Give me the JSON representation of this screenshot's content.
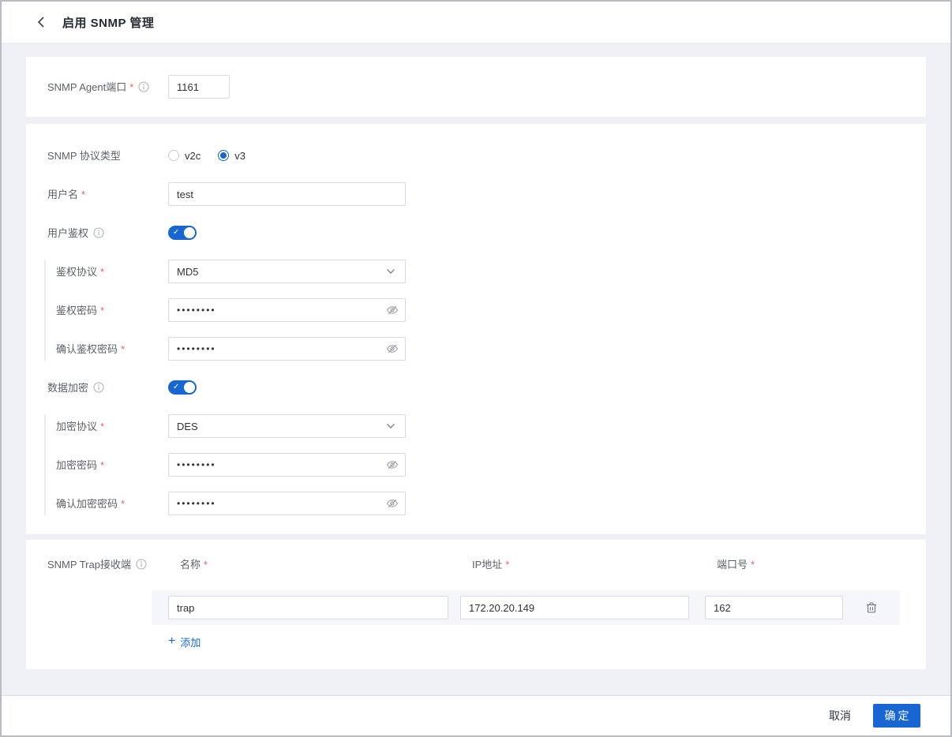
{
  "header": {
    "title": "启用 SNMP 管理"
  },
  "required_mark": "*",
  "agent": {
    "label": "SNMP Agent端口",
    "port": "1161"
  },
  "protocol": {
    "label": "SNMP 协议类型",
    "options": [
      {
        "label": "v2c",
        "checked": false
      },
      {
        "label": "v3",
        "checked": true
      }
    ],
    "selected": "v3"
  },
  "username": {
    "label": "用户名",
    "value": "test"
  },
  "auth": {
    "toggle_label": "用户鉴权",
    "enabled": true,
    "protocol": {
      "label": "鉴权协议",
      "value": "MD5"
    },
    "password": {
      "label": "鉴权密码",
      "value": "••••••••"
    },
    "confirm": {
      "label": "确认鉴权密码",
      "value": "••••••••"
    }
  },
  "encryption": {
    "toggle_label": "数据加密",
    "enabled": true,
    "protocol": {
      "label": "加密协议",
      "value": "DES"
    },
    "password": {
      "label": "加密密码",
      "value": "••••••••"
    },
    "confirm": {
      "label": "确认加密密码",
      "value": "••••••••"
    }
  },
  "trap": {
    "label": "SNMP Trap接收端",
    "columns": [
      {
        "label": "名称"
      },
      {
        "label": "IP地址"
      },
      {
        "label": "端口号"
      }
    ],
    "rows": [
      {
        "name": "trap",
        "ip": "172.20.20.149",
        "port": "162"
      }
    ],
    "add": {
      "icon": "+",
      "label": "添加"
    }
  },
  "footer": {
    "cancel": "取消",
    "confirm": "确定"
  },
  "colors": {
    "primary": "#1766d1",
    "required": "#f15f5f",
    "page_bg": "#eef0f5",
    "row_bg": "#f5f6fa"
  }
}
